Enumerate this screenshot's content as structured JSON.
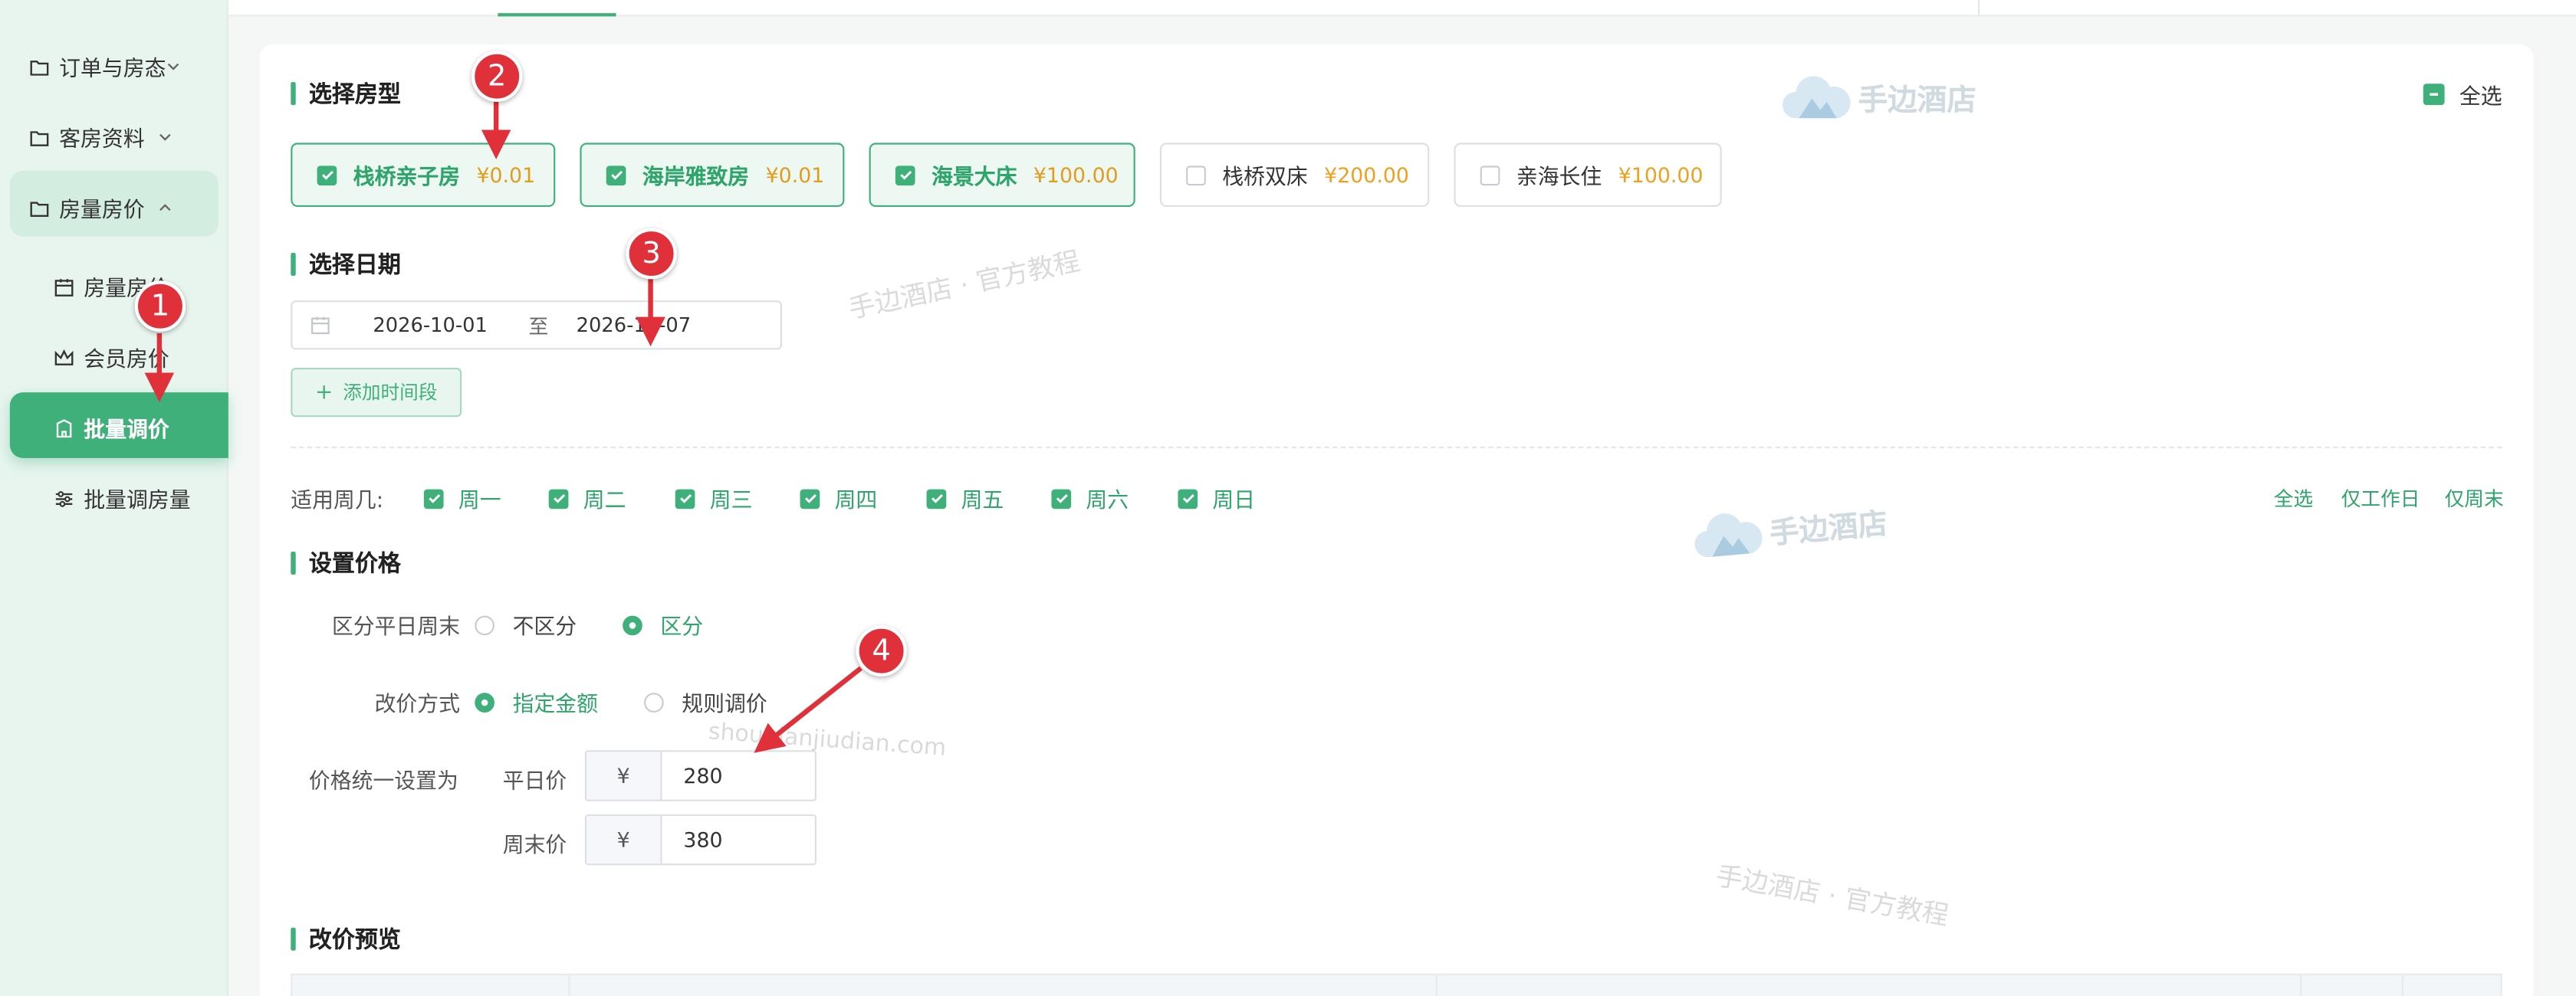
{
  "sidebar": {
    "items": [
      {
        "label": "订单与房态",
        "icon": "folder-icon"
      },
      {
        "label": "客房资料",
        "icon": "folder-icon"
      },
      {
        "label": "房量房价",
        "icon": "folder-icon"
      },
      {
        "label": "房量房价",
        "icon": "calendar-icon"
      },
      {
        "label": "会员房价",
        "icon": "crown-icon"
      },
      {
        "label": "批量调价",
        "icon": "building-icon"
      },
      {
        "label": "批量调房量",
        "icon": "sliders-icon"
      }
    ]
  },
  "room_section": {
    "title": "选择房型",
    "select_all": "全选"
  },
  "rooms": [
    {
      "name": "栈桥亲子房",
      "price": "¥0.01",
      "checked": true
    },
    {
      "name": "海岸雅致房",
      "price": "¥0.01",
      "checked": true
    },
    {
      "name": "海景大床",
      "price": "¥100.00",
      "checked": true
    },
    {
      "name": "栈桥双床",
      "price": "¥200.00",
      "checked": false
    },
    {
      "name": "亲海长住",
      "price": "¥100.00",
      "checked": false
    }
  ],
  "date_section": {
    "title": "选择日期",
    "start": "2026-10-01",
    "separator": "至",
    "end": "2026-10-07",
    "add_button": "添加时间段"
  },
  "weekday": {
    "label": "适用周几:",
    "days": [
      "周一",
      "周二",
      "周三",
      "周四",
      "周五",
      "周六",
      "周日"
    ],
    "links": [
      "全选",
      "仅工作日",
      "仅周末"
    ]
  },
  "price_section": {
    "title": "设置价格",
    "distinguish_label": "区分平日周末",
    "opt_no": "不区分",
    "opt_yes": "区分",
    "method_label": "改价方式",
    "method_fixed": "指定金额",
    "method_rule": "规则调价",
    "unified_label": "价格统一设置为",
    "weekday_label": "平日价",
    "weekend_label": "周末价",
    "currency": "¥",
    "weekday_price": "280",
    "weekend_price": "380"
  },
  "preview_section": {
    "title": "改价预览"
  },
  "watermarks": {
    "brand": "手边酒店",
    "tutorial": "手边酒店 · 官方教程",
    "url": "shoubianjiudian.com"
  },
  "markers": [
    "1",
    "2",
    "3",
    "4"
  ],
  "colors": {
    "accent": "#3fb07a",
    "price": "#f0a020",
    "marker": "#e0303a"
  }
}
